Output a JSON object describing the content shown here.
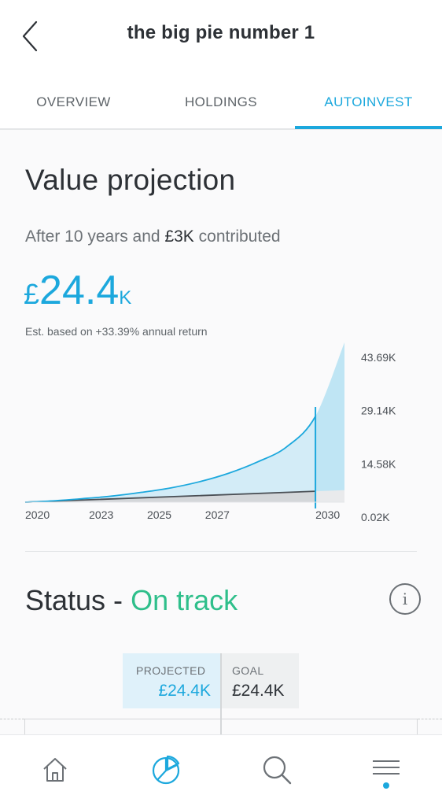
{
  "header": {
    "title": "the big pie number 1",
    "back_icon": "chevron-left-icon"
  },
  "tabs": [
    {
      "label": "OVERVIEW",
      "active": false
    },
    {
      "label": "HOLDINGS",
      "active": false
    },
    {
      "label": "AUTOINVEST",
      "active": true
    }
  ],
  "projection": {
    "title": "Value projection",
    "subtitle_prefix": "After 10 years and ",
    "subtitle_amount": "£3K",
    "subtitle_suffix": " contributed",
    "value_currency": "£",
    "value_number": "24.4",
    "value_unit": "K",
    "estimate_note": "Est. based on +33.39% annual return"
  },
  "chart_data": {
    "type": "area",
    "x_ticks": [
      "2020",
      "2023",
      "2025",
      "2027",
      "2030"
    ],
    "y_ticks": [
      "43.69K",
      "29.14K",
      "14.58K",
      "0.02K"
    ],
    "ylim": [
      0.02,
      43.69
    ],
    "marker_year": 2030,
    "series": [
      {
        "x": [
          2020,
          2021,
          2022,
          2023,
          2024,
          2025,
          2026,
          2027,
          2028,
          2029,
          2030,
          2031
        ],
        "values": [
          0.02,
          0.4,
          1.0,
          1.7,
          2.7,
          3.9,
          5.6,
          7.9,
          11.0,
          15.1,
          23.5,
          43.69
        ],
        "color": "#1ca8dd"
      },
      {
        "x": [
          2020,
          2030,
          2031
        ],
        "values": [
          0.02,
          3.0,
          3.3
        ],
        "color": "#4a4f55"
      }
    ]
  },
  "status": {
    "label": "Status - ",
    "value": "On track",
    "info_icon": "info-icon",
    "projected_label": "PROJECTED",
    "projected_value": "£24.4K",
    "goal_label": "GOAL",
    "goal_value": "£24.4K"
  },
  "nav": {
    "items": [
      "home-icon",
      "pie-chart-icon",
      "search-icon",
      "menu-icon"
    ],
    "active_index": 1
  },
  "colors": {
    "accent": "#1ca8dd",
    "success": "#2fbf8b",
    "text": "#2d3136",
    "muted": "#6c7176"
  }
}
